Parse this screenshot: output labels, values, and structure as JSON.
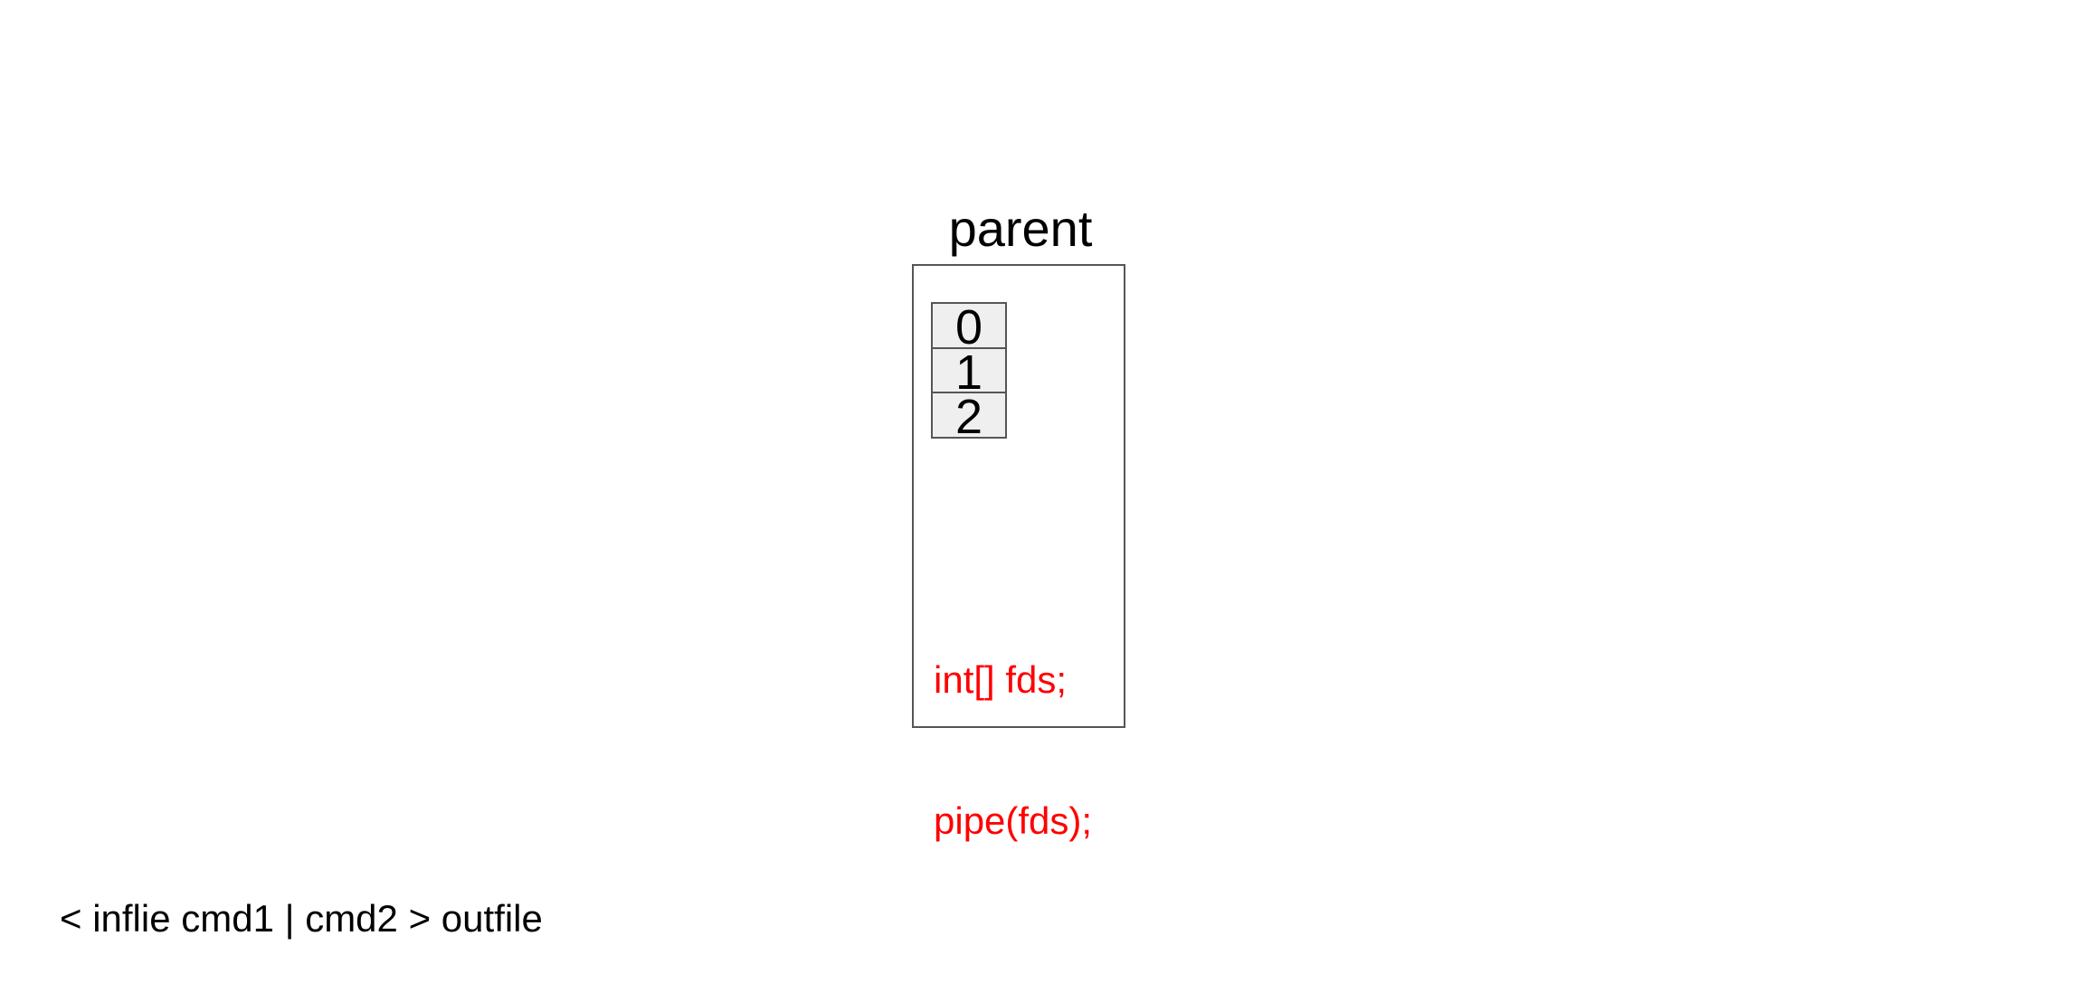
{
  "process": {
    "title": "parent",
    "fd_table": [
      "0",
      "1",
      "2"
    ],
    "code": [
      "int[] fds;",
      "pipe(fds);"
    ]
  },
  "command": "< inflie cmd1 | cmd2 > outfile",
  "colors": {
    "box_border": "#555555",
    "fd_cell_fill": "#efefef",
    "code_text": "#ff0000",
    "text": "#000000"
  }
}
